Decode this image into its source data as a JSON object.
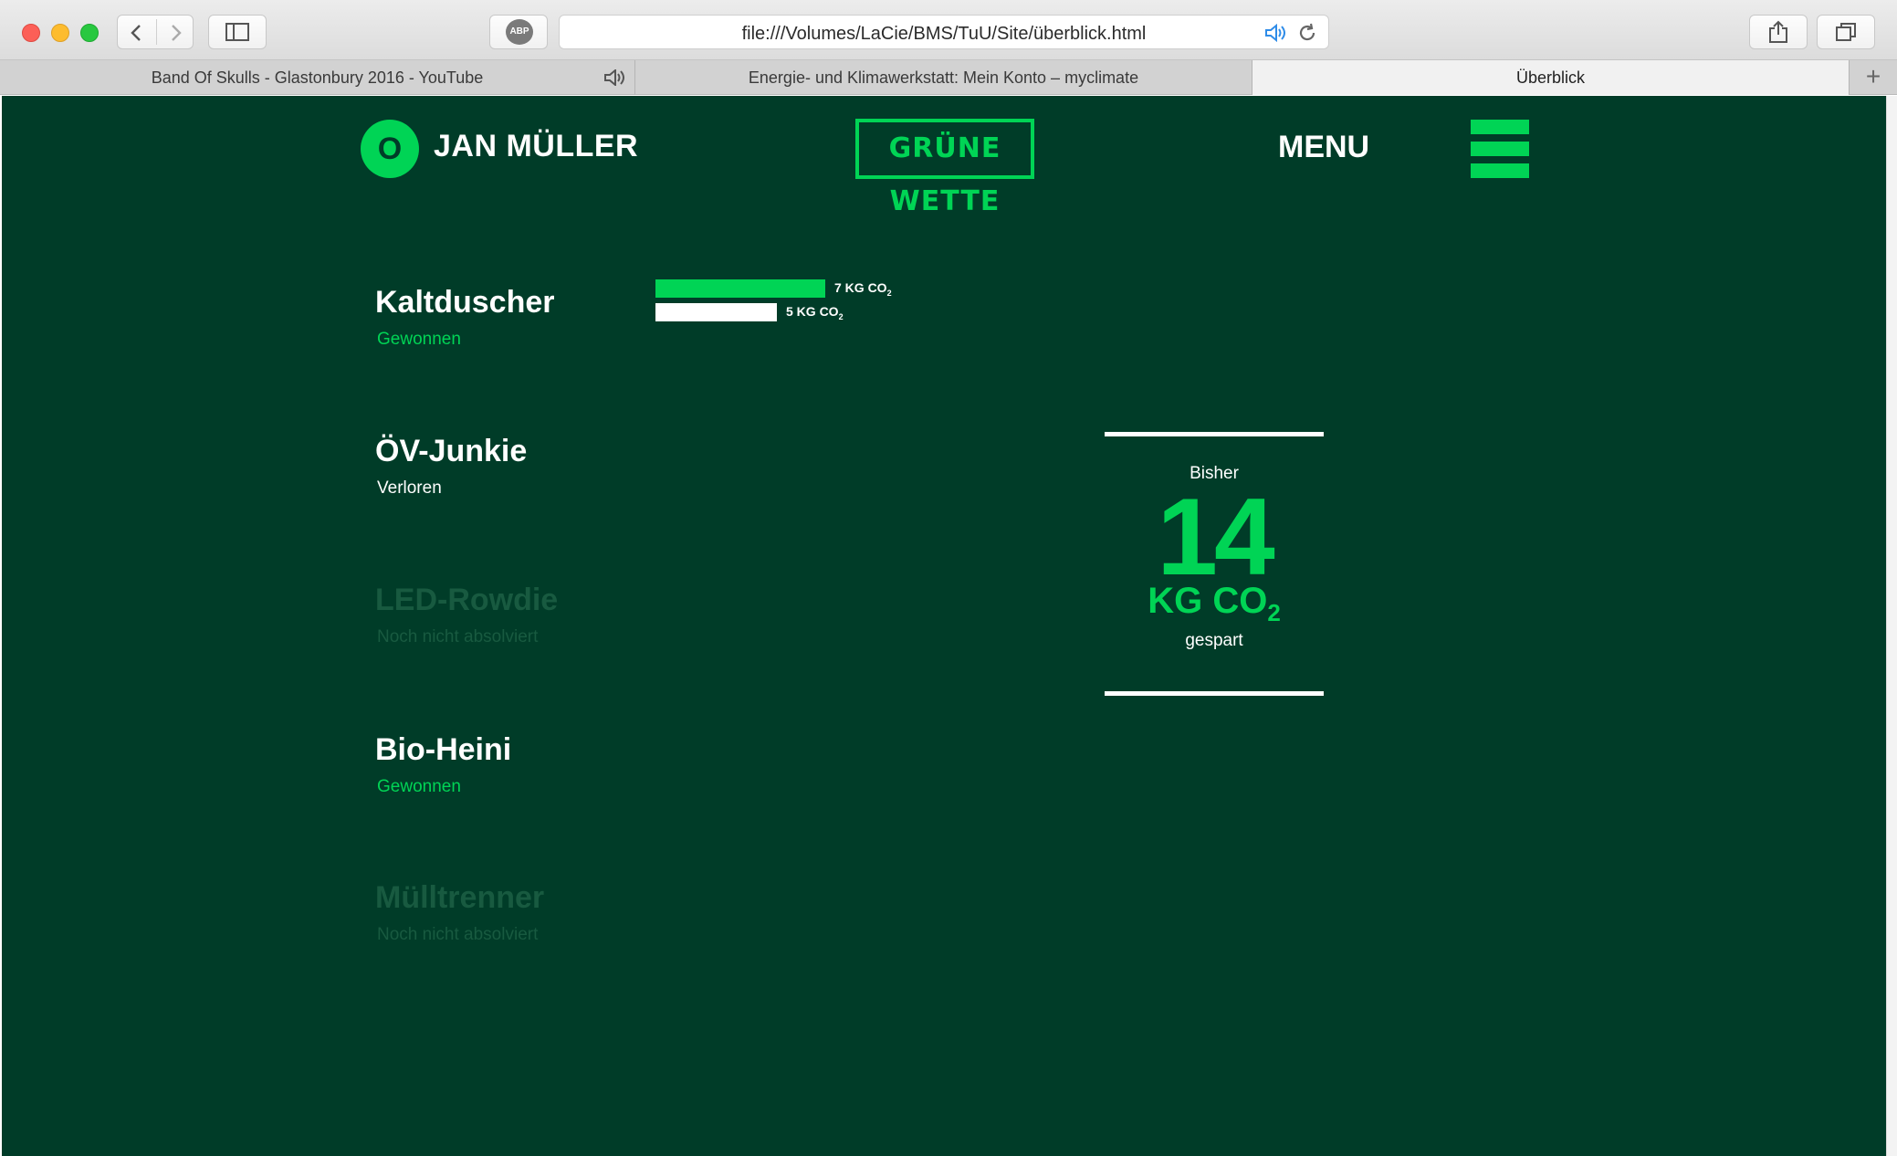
{
  "browser": {
    "url": "file:///Volumes/LaCie/BMS/TuU/Site/überblick.html",
    "abp_label": "ABP",
    "tabs": [
      {
        "label": "Band Of Skulls - Glastonbury 2016 - YouTube",
        "playing_audio": true
      },
      {
        "label": "Energie- und Klimawerkstatt: Mein Konto – myclimate",
        "playing_audio": false
      },
      {
        "label": "Überblick",
        "active": true
      }
    ],
    "new_tab_label": "+"
  },
  "header": {
    "avatar_letter": "O",
    "user_name": "JAN MÜLLER",
    "logo_text": "GRÜNE WETTE",
    "menu_label": "MENU"
  },
  "challenges": [
    {
      "title": "Kaltduscher",
      "status": "Gewonnen"
    },
    {
      "title": "ÖV-Junkie",
      "status": "Verloren"
    },
    {
      "title": "LED-Rowdie",
      "status": "Noch nicht absolviert"
    },
    {
      "title": "Bio-Heini",
      "status": "Gewonnen"
    },
    {
      "title": "Mülltrenner",
      "status": "Noch nicht absolviert"
    }
  ],
  "comparison": [
    {
      "value": 7,
      "label_prefix": "7 KG CO",
      "sub": "2",
      "color": "#00d455"
    },
    {
      "value": 5,
      "label_prefix": "5 KG CO",
      "sub": "2",
      "color": "#ffffff"
    }
  ],
  "total": {
    "prefix": "Bisher",
    "value": "14",
    "unit": "KG CO",
    "unit_sub": "2",
    "suffix": "gespart"
  },
  "colors": {
    "background": "#003c28",
    "accent": "#00d455",
    "faded": "#185a40"
  }
}
